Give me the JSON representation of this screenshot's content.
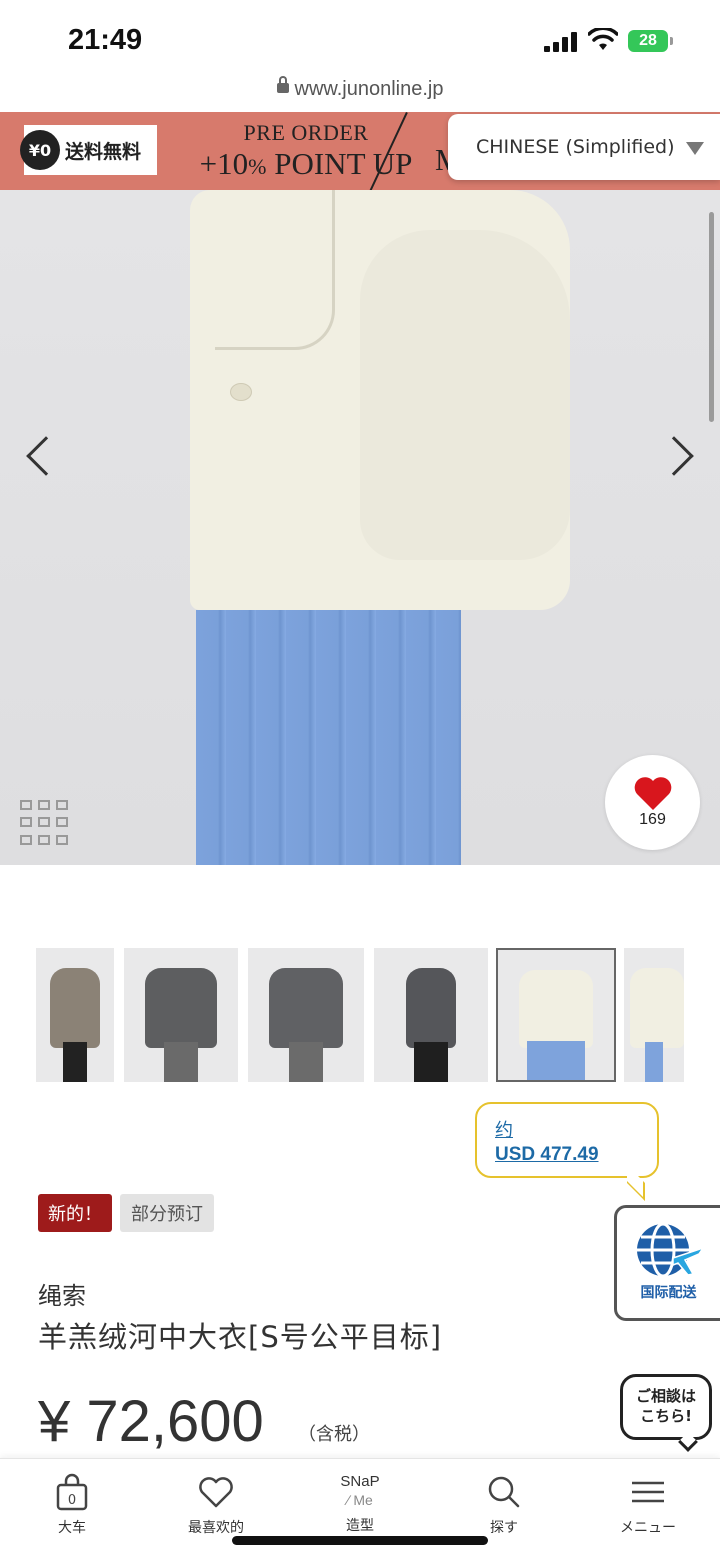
{
  "status_bar": {
    "time": "21:49",
    "battery": "28"
  },
  "browser": {
    "url": "www.junonline.jp"
  },
  "banner": {
    "yen_badge": "¥0",
    "free_shipping": "送料無料",
    "preorder_line1": "PRE ORDER",
    "preorder_line2_main": "+10",
    "preorder_line2_small": "%",
    "preorder_line2_tail": " POINT UP",
    "cut_text": "M"
  },
  "language_select": {
    "value": "CHINESE (Simplified)"
  },
  "gallery": {
    "favorite_count": "169"
  },
  "currency": {
    "about": "约",
    "amount": "USD 477.49"
  },
  "tags": {
    "new": "新的！",
    "preorder": "部分预订"
  },
  "shipping_badge": {
    "label": "国际配送"
  },
  "product": {
    "brand": "绳索",
    "name": "羊羔绒河中大衣[S号公平目标]",
    "price": "¥ 72,600",
    "tax": "（含税）"
  },
  "consult": {
    "line1": "ご相談は",
    "line2": "こちら!"
  },
  "nav": {
    "cart_label": "大车",
    "cart_count": "0",
    "favorites_label": "最喜欢的",
    "snap_top": "SNaP",
    "snap_bottom": "∕ Me",
    "style_label": "造型",
    "search_label": "探す",
    "menu_label": "メニュー"
  },
  "colors": {
    "banner": "#d77a6c",
    "new_tag": "#9e1b1b",
    "link": "#1d6aa6",
    "tooltip_border": "#e6c22d",
    "heart": "#d8161d"
  },
  "icons": [
    "signal-icon",
    "wifi-icon",
    "battery-icon",
    "lock-icon",
    "chevron-down-icon",
    "chevron-left-icon",
    "chevron-right-icon",
    "grid-icon",
    "heart-icon",
    "globe-plane-icon",
    "cart-icon",
    "heart-outline-icon",
    "search-icon",
    "menu-icon"
  ]
}
